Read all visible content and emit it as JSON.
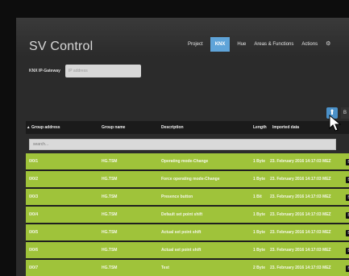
{
  "app": {
    "title": "SV Control"
  },
  "nav": {
    "items": [
      {
        "label": "Project",
        "active": false
      },
      {
        "label": "KNX",
        "active": true
      },
      {
        "label": "Hue",
        "active": false
      },
      {
        "label": "Areas & Functions",
        "active": false
      },
      {
        "label": "Actions",
        "active": false
      }
    ],
    "settings_icon": "⚙"
  },
  "gateway": {
    "label": "KNX IP-Gateway",
    "placeholder": "IP address",
    "value": ""
  },
  "toolbar": {
    "primary_icon": "⬆",
    "secondary_icon": "B"
  },
  "table": {
    "headers": [
      "Group address",
      "Group name",
      "Description",
      "Length",
      "Imported data"
    ],
    "sort_indicator": "▴",
    "filter_placeholder": "search...",
    "rows": [
      {
        "address": "0/0/1",
        "group": "HG.TSM",
        "description": "Operating mode-Change",
        "length": "1 Byte",
        "date": "23. February 2016 14:17:03 MEZ"
      },
      {
        "address": "0/0/2",
        "group": "HG.TSM",
        "description": "Force operating mode-Change",
        "length": "1 Byte",
        "date": "23. February 2016 14:17:03 MEZ"
      },
      {
        "address": "0/0/3",
        "group": "HG.TSM",
        "description": "Presence button",
        "length": "1 Bit",
        "date": "23. February 2016 14:17:03 MEZ"
      },
      {
        "address": "0/0/4",
        "group": "HG.TSM",
        "description": "Default set point shift",
        "length": "1 Byte",
        "date": "23. February 2016 14:17:03 MEZ"
      },
      {
        "address": "0/0/5",
        "group": "HG.TSM",
        "description": "Actual set point shift",
        "length": "1 Byte",
        "date": "23. February 2016 14:17:03 MEZ"
      },
      {
        "address": "0/0/6",
        "group": "HG.TSM",
        "description": "Actual set point shift",
        "length": "1 Byte",
        "date": "23. February 2016 14:17:03 MEZ"
      },
      {
        "address": "0/0/7",
        "group": "HG.TSM",
        "description": "Test",
        "length": "2 Byte",
        "date": "23. February 2016 14:17:03 MEZ"
      }
    ],
    "row_action_icon": "B"
  },
  "colors": {
    "row_green": "#9fc33a",
    "nav_active": "#5fa4d9",
    "header_bg": "#1b1b1b"
  }
}
